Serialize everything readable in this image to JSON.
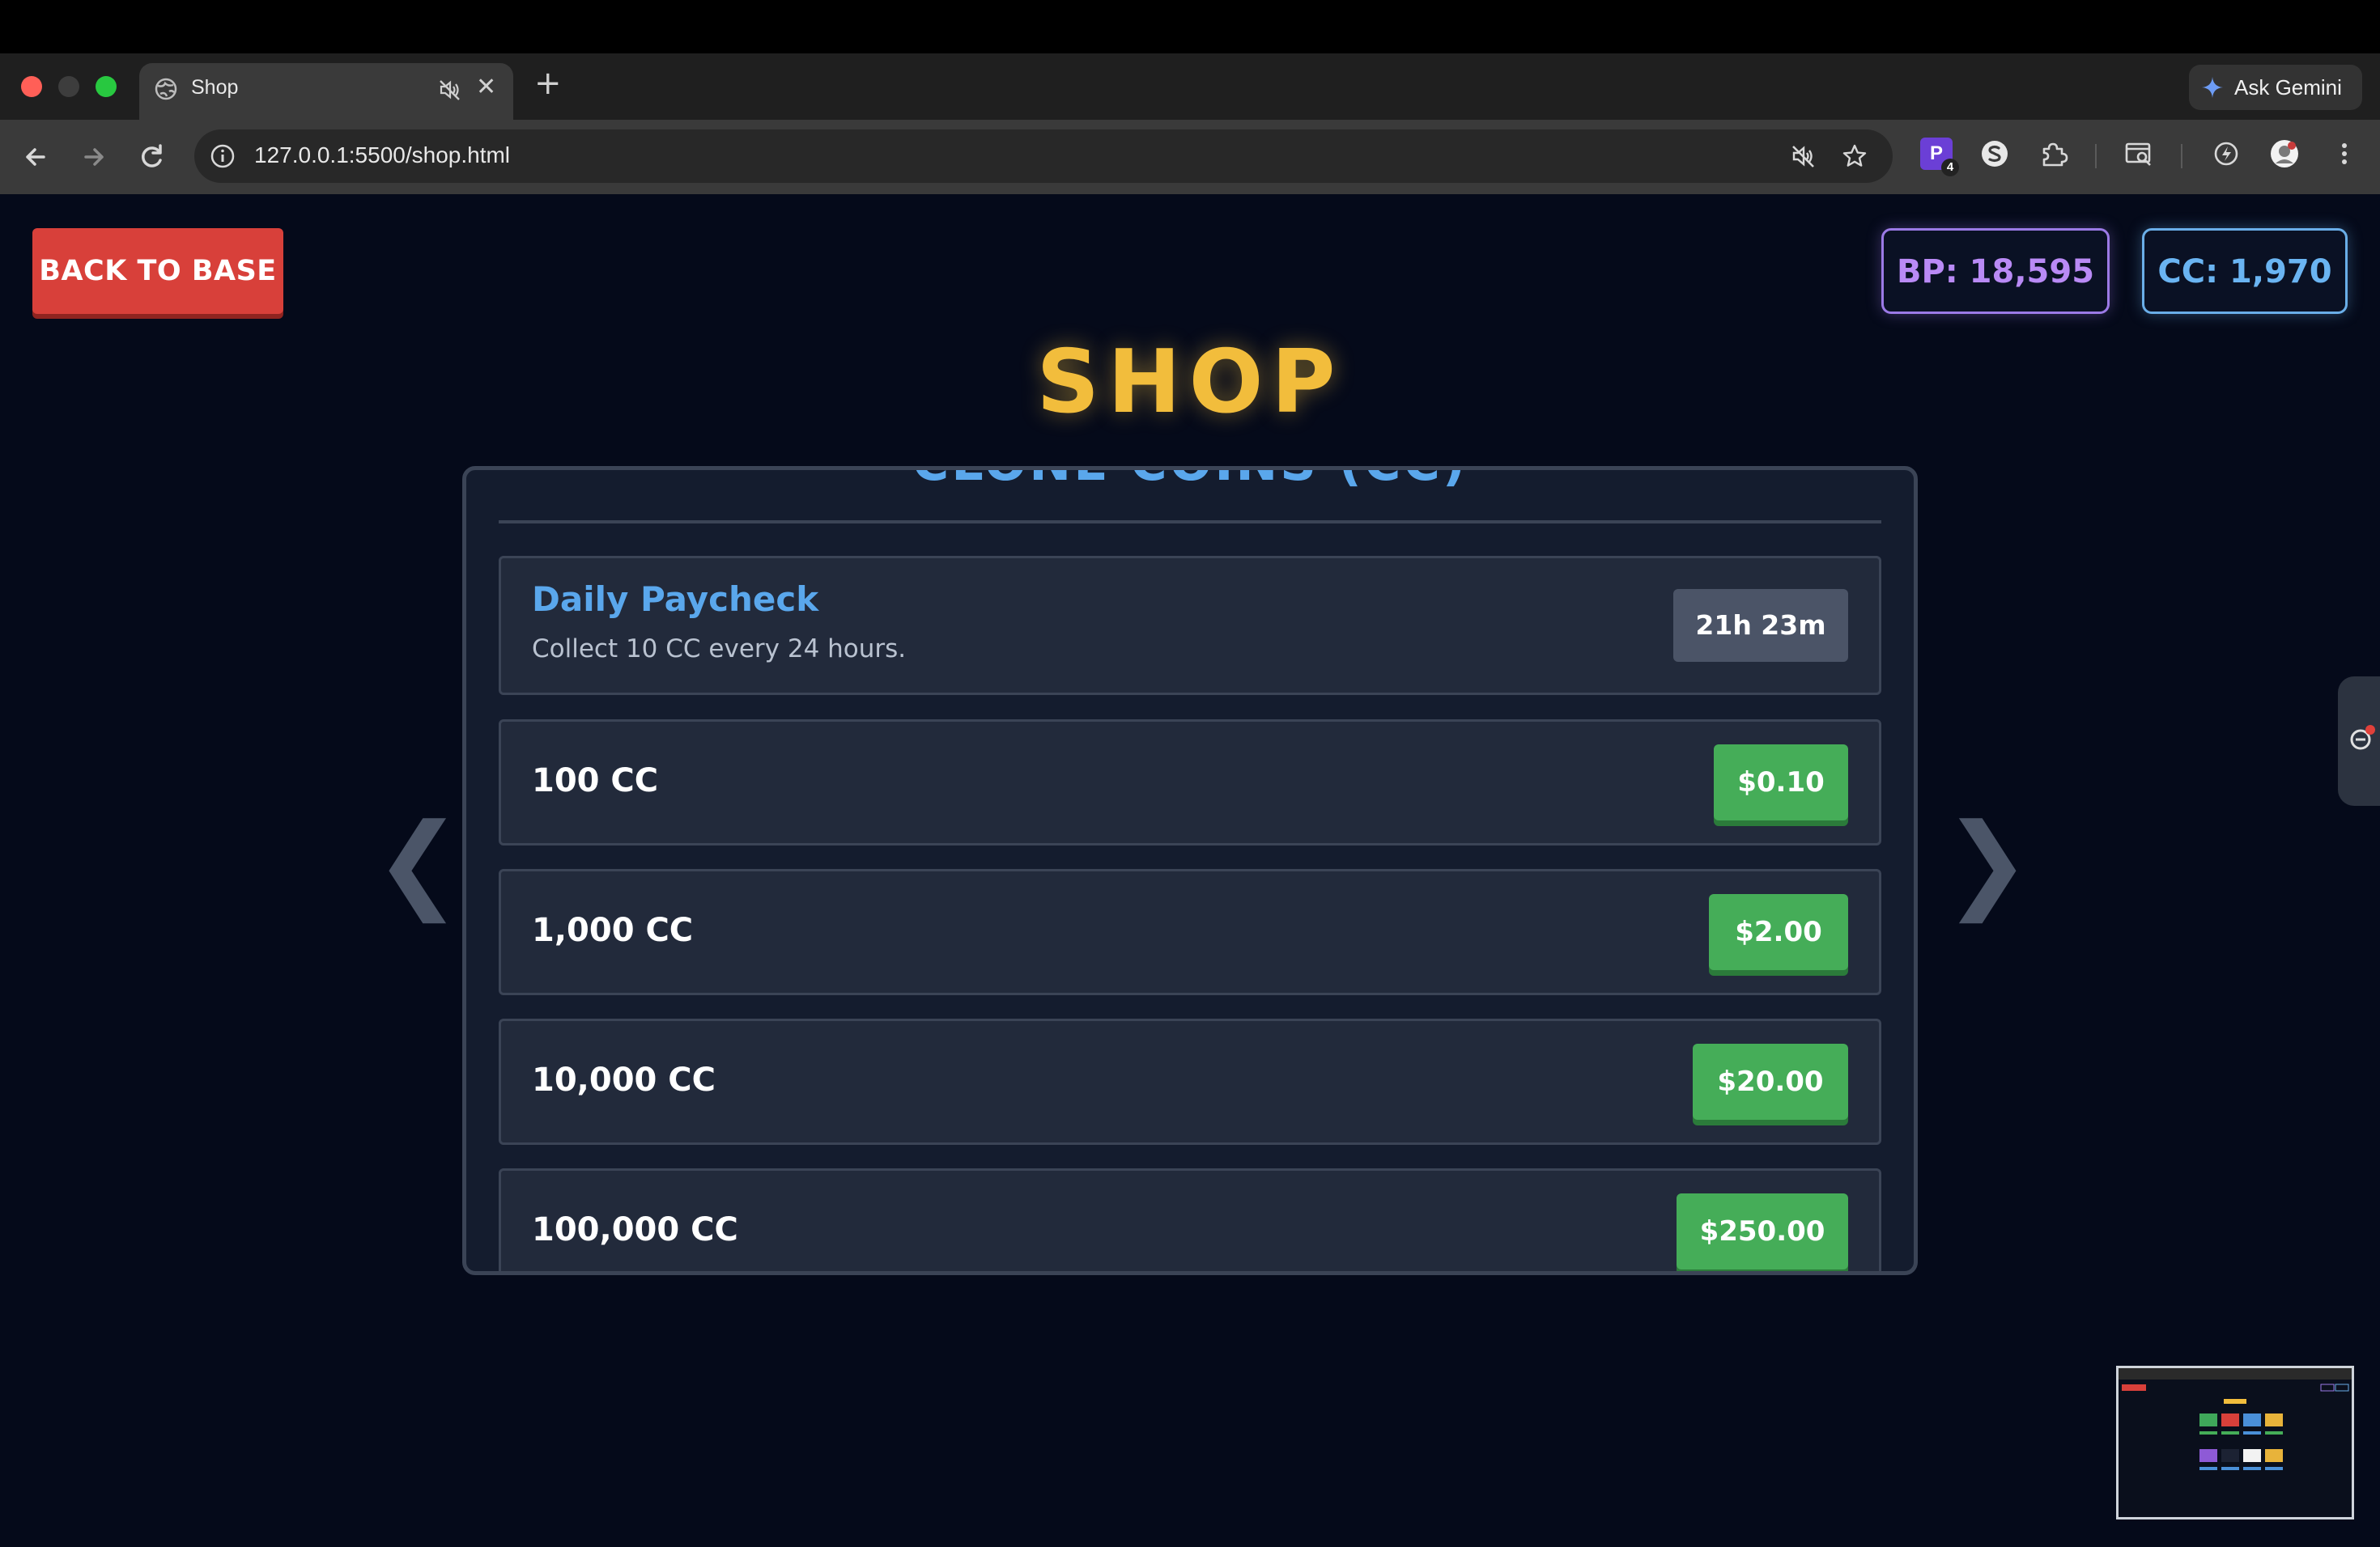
{
  "browser": {
    "tab_title": "Shop",
    "tab_close": "✕",
    "new_tab": "+",
    "url": "127.0.0.1:5500/shop.html",
    "gemini_label": "Ask Gemini",
    "extension_p_letter": "P",
    "extension_p_badge": "4"
  },
  "header": {
    "back_label": "BACK TO BASE",
    "bp_label": "BP: 18,595",
    "cc_label": "CC: 1,970"
  },
  "shop": {
    "title": "SHOP",
    "section_title": "CLONE COINS (CC)",
    "prev_arrow": "❮",
    "next_arrow": "❯",
    "paycheck": {
      "title": "Daily Paycheck",
      "description": "Collect 10 CC every 24 hours.",
      "timer": "21h 23m"
    },
    "items": [
      {
        "label": "100 CC",
        "price": "$0.10"
      },
      {
        "label": "1,000 CC",
        "price": "$2.00"
      },
      {
        "label": "10,000 CC",
        "price": "$20.00"
      },
      {
        "label": "100,000 CC",
        "price": "$250.00"
      }
    ]
  },
  "colors": {
    "accent_gold": "#f2bd3c",
    "accent_blue": "#5aa7ec",
    "buy_green": "#45ad58",
    "back_red": "#d8403a",
    "bp_purple": "#b98af5"
  }
}
